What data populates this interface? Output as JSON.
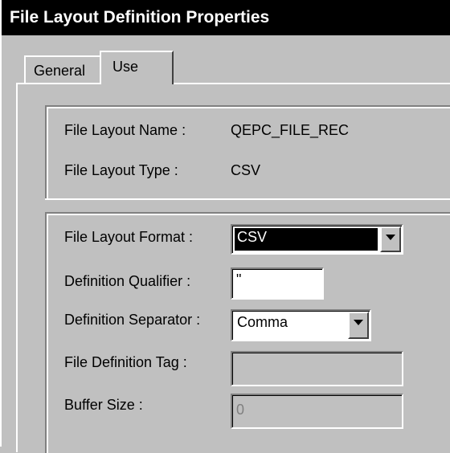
{
  "window": {
    "title": "File Layout Definition Properties"
  },
  "tabs": [
    {
      "label": "General"
    },
    {
      "label": "Use"
    }
  ],
  "info": {
    "name_label": "File Layout Name :",
    "name_value": "QEPC_FILE_REC",
    "type_label": "File Layout Type :",
    "type_value": "CSV"
  },
  "form": {
    "format_label": "File Layout Format :",
    "format_value": "CSV",
    "qualifier_label": "Definition Qualifier :",
    "qualifier_value": "\"",
    "separator_label": "Definition Separator :",
    "separator_value": "Comma",
    "tag_label": "File Definition Tag :",
    "tag_value": "",
    "buffer_label": "Buffer Size :",
    "buffer_value": "0"
  },
  "icons": {
    "dropdown": "chevron-down-icon"
  },
  "colors": {
    "face": "#c0c0c0",
    "titlebar": "#000000",
    "selection": "#000000"
  }
}
